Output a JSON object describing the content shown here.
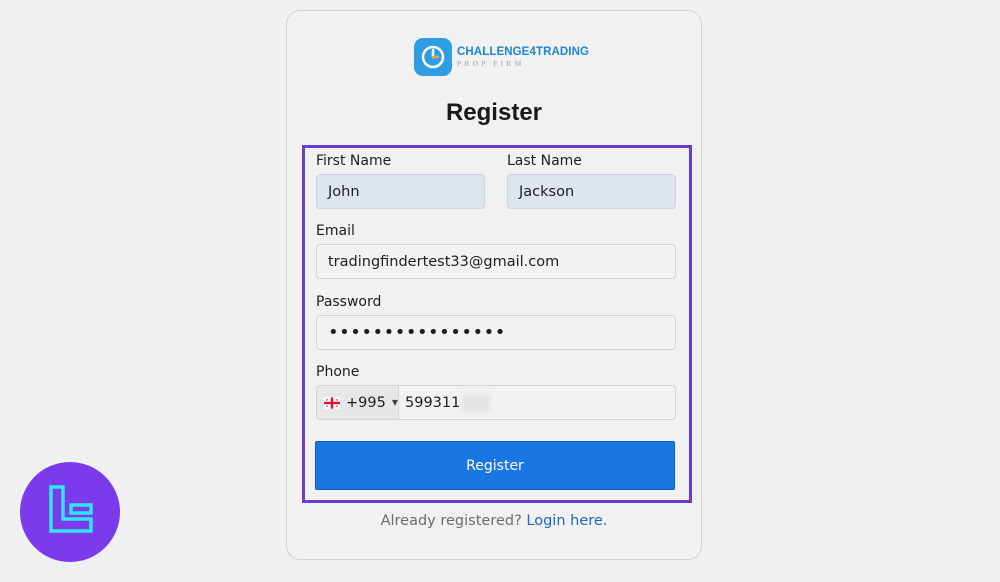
{
  "logo": {
    "title": "CHALLENGE4TRADING",
    "subtitle": "PROP FIRM"
  },
  "form": {
    "title": "Register",
    "first_name": {
      "label": "First Name",
      "value": "John"
    },
    "last_name": {
      "label": "Last Name",
      "value": "Jackson"
    },
    "email": {
      "label": "Email",
      "value": "tradingfindertest33@gmail.com"
    },
    "password": {
      "label": "Password",
      "value": "••••••••••••••••"
    },
    "phone": {
      "label": "Phone",
      "country_code": "+995",
      "value": "599311"
    },
    "submit_label": "Register"
  },
  "footer": {
    "prefix": "Already registered?",
    "link": "Login here."
  },
  "colors": {
    "accent": "#1877e4",
    "highlight_border": "#6a3dc8",
    "link": "#1d63c4",
    "badge": "#7c3aed"
  }
}
